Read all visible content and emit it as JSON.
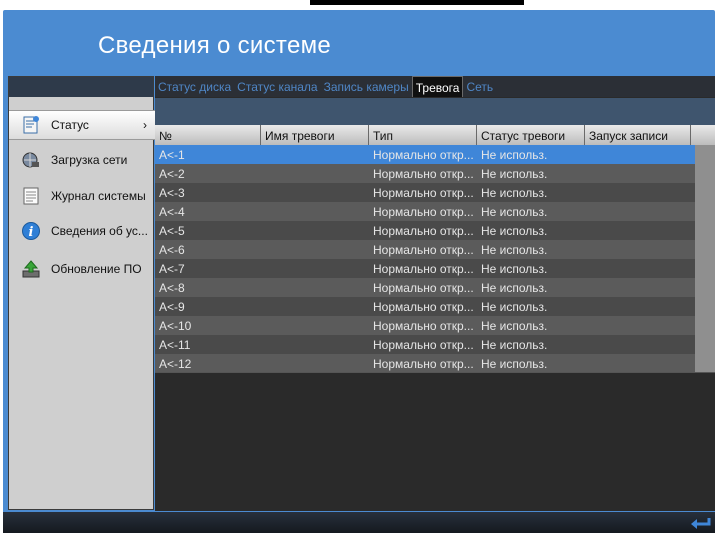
{
  "window": {
    "title": "Сведения о системе"
  },
  "sidebar": {
    "items": [
      {
        "label": "Статус",
        "icon": "status-doc-icon",
        "active": true,
        "chevron": "›"
      },
      {
        "label": "Загрузка сети",
        "icon": "network-load-icon"
      },
      {
        "label": "Журнал системы",
        "icon": "system-log-icon"
      },
      {
        "label": "Сведения об ус...",
        "icon": "device-info-icon"
      },
      {
        "label": "Обновление ПО",
        "icon": "software-update-icon"
      }
    ]
  },
  "tabs": [
    {
      "label": "Статус диска"
    },
    {
      "label": "Статус канала"
    },
    {
      "label": "Запись камеры"
    },
    {
      "label": "Тревога",
      "active": true
    },
    {
      "label": "Сеть"
    }
  ],
  "table": {
    "columns": [
      "№",
      "Имя тревоги",
      "Тип",
      "Статус тревоги",
      "Запуск записи"
    ],
    "rows": [
      [
        "A<-1",
        "",
        "Нормально откр...",
        "Не использ.",
        ""
      ],
      [
        "A<-2",
        "",
        "Нормально откр...",
        "Не использ.",
        ""
      ],
      [
        "A<-3",
        "",
        "Нормально откр...",
        "Не использ.",
        ""
      ],
      [
        "A<-4",
        "",
        "Нормально откр...",
        "Не использ.",
        ""
      ],
      [
        "A<-5",
        "",
        "Нормально откр...",
        "Не использ.",
        ""
      ],
      [
        "A<-6",
        "",
        "Нормально откр...",
        "Не использ.",
        ""
      ],
      [
        "A<-7",
        "",
        "Нормально откр...",
        "Не использ.",
        ""
      ],
      [
        "A<-8",
        "",
        "Нормально откр...",
        "Не использ.",
        ""
      ],
      [
        "A<-9",
        "",
        "Нормально откр...",
        "Не использ.",
        ""
      ],
      [
        "A<-10",
        "",
        "Нормально откр...",
        "Не использ.",
        ""
      ],
      [
        "A<-11",
        "",
        "Нормально откр...",
        "Не использ.",
        ""
      ],
      [
        "A<-12",
        "",
        "Нормально откр...",
        "Не использ.",
        ""
      ]
    ],
    "selected_row": 0
  },
  "colors": {
    "accent": "#4b8bd1",
    "selected_row": "#3f86d8",
    "row_even": "#4a4a4a",
    "row_odd": "#5b5b5b"
  },
  "footer": {
    "back_icon": "back-arrow-icon"
  }
}
